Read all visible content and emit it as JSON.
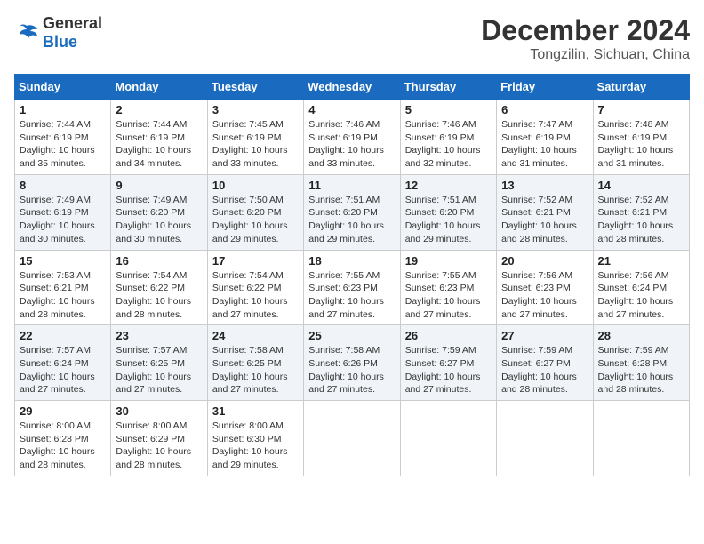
{
  "header": {
    "logo_general": "General",
    "logo_blue": "Blue",
    "title": "December 2024",
    "location": "Tongzilin, Sichuan, China"
  },
  "calendar": {
    "days_of_week": [
      "Sunday",
      "Monday",
      "Tuesday",
      "Wednesday",
      "Thursday",
      "Friday",
      "Saturday"
    ],
    "weeks": [
      [
        null,
        {
          "day": "2",
          "sunrise": "7:44 AM",
          "sunset": "6:19 PM",
          "daylight": "10 hours and 34 minutes."
        },
        {
          "day": "3",
          "sunrise": "7:45 AM",
          "sunset": "6:19 PM",
          "daylight": "10 hours and 33 minutes."
        },
        {
          "day": "4",
          "sunrise": "7:46 AM",
          "sunset": "6:19 PM",
          "daylight": "10 hours and 33 minutes."
        },
        {
          "day": "5",
          "sunrise": "7:46 AM",
          "sunset": "6:19 PM",
          "daylight": "10 hours and 32 minutes."
        },
        {
          "day": "6",
          "sunrise": "7:47 AM",
          "sunset": "6:19 PM",
          "daylight": "10 hours and 31 minutes."
        },
        {
          "day": "7",
          "sunrise": "7:48 AM",
          "sunset": "6:19 PM",
          "daylight": "10 hours and 31 minutes."
        }
      ],
      [
        {
          "day": "1",
          "sunrise": "7:44 AM",
          "sunset": "6:19 PM",
          "daylight": "10 hours and 35 minutes."
        },
        null,
        null,
        null,
        null,
        null,
        null
      ],
      [
        {
          "day": "8",
          "sunrise": "7:49 AM",
          "sunset": "6:19 PM",
          "daylight": "10 hours and 30 minutes."
        },
        {
          "day": "9",
          "sunrise": "7:49 AM",
          "sunset": "6:20 PM",
          "daylight": "10 hours and 30 minutes."
        },
        {
          "day": "10",
          "sunrise": "7:50 AM",
          "sunset": "6:20 PM",
          "daylight": "10 hours and 29 minutes."
        },
        {
          "day": "11",
          "sunrise": "7:51 AM",
          "sunset": "6:20 PM",
          "daylight": "10 hours and 29 minutes."
        },
        {
          "day": "12",
          "sunrise": "7:51 AM",
          "sunset": "6:20 PM",
          "daylight": "10 hours and 29 minutes."
        },
        {
          "day": "13",
          "sunrise": "7:52 AM",
          "sunset": "6:21 PM",
          "daylight": "10 hours and 28 minutes."
        },
        {
          "day": "14",
          "sunrise": "7:52 AM",
          "sunset": "6:21 PM",
          "daylight": "10 hours and 28 minutes."
        }
      ],
      [
        {
          "day": "15",
          "sunrise": "7:53 AM",
          "sunset": "6:21 PM",
          "daylight": "10 hours and 28 minutes."
        },
        {
          "day": "16",
          "sunrise": "7:54 AM",
          "sunset": "6:22 PM",
          "daylight": "10 hours and 28 minutes."
        },
        {
          "day": "17",
          "sunrise": "7:54 AM",
          "sunset": "6:22 PM",
          "daylight": "10 hours and 27 minutes."
        },
        {
          "day": "18",
          "sunrise": "7:55 AM",
          "sunset": "6:23 PM",
          "daylight": "10 hours and 27 minutes."
        },
        {
          "day": "19",
          "sunrise": "7:55 AM",
          "sunset": "6:23 PM",
          "daylight": "10 hours and 27 minutes."
        },
        {
          "day": "20",
          "sunrise": "7:56 AM",
          "sunset": "6:23 PM",
          "daylight": "10 hours and 27 minutes."
        },
        {
          "day": "21",
          "sunrise": "7:56 AM",
          "sunset": "6:24 PM",
          "daylight": "10 hours and 27 minutes."
        }
      ],
      [
        {
          "day": "22",
          "sunrise": "7:57 AM",
          "sunset": "6:24 PM",
          "daylight": "10 hours and 27 minutes."
        },
        {
          "day": "23",
          "sunrise": "7:57 AM",
          "sunset": "6:25 PM",
          "daylight": "10 hours and 27 minutes."
        },
        {
          "day": "24",
          "sunrise": "7:58 AM",
          "sunset": "6:25 PM",
          "daylight": "10 hours and 27 minutes."
        },
        {
          "day": "25",
          "sunrise": "7:58 AM",
          "sunset": "6:26 PM",
          "daylight": "10 hours and 27 minutes."
        },
        {
          "day": "26",
          "sunrise": "7:59 AM",
          "sunset": "6:27 PM",
          "daylight": "10 hours and 27 minutes."
        },
        {
          "day": "27",
          "sunrise": "7:59 AM",
          "sunset": "6:27 PM",
          "daylight": "10 hours and 28 minutes."
        },
        {
          "day": "28",
          "sunrise": "7:59 AM",
          "sunset": "6:28 PM",
          "daylight": "10 hours and 28 minutes."
        }
      ],
      [
        {
          "day": "29",
          "sunrise": "8:00 AM",
          "sunset": "6:28 PM",
          "daylight": "10 hours and 28 minutes."
        },
        {
          "day": "30",
          "sunrise": "8:00 AM",
          "sunset": "6:29 PM",
          "daylight": "10 hours and 28 minutes."
        },
        {
          "day": "31",
          "sunrise": "8:00 AM",
          "sunset": "6:30 PM",
          "daylight": "10 hours and 29 minutes."
        },
        null,
        null,
        null,
        null
      ]
    ]
  }
}
